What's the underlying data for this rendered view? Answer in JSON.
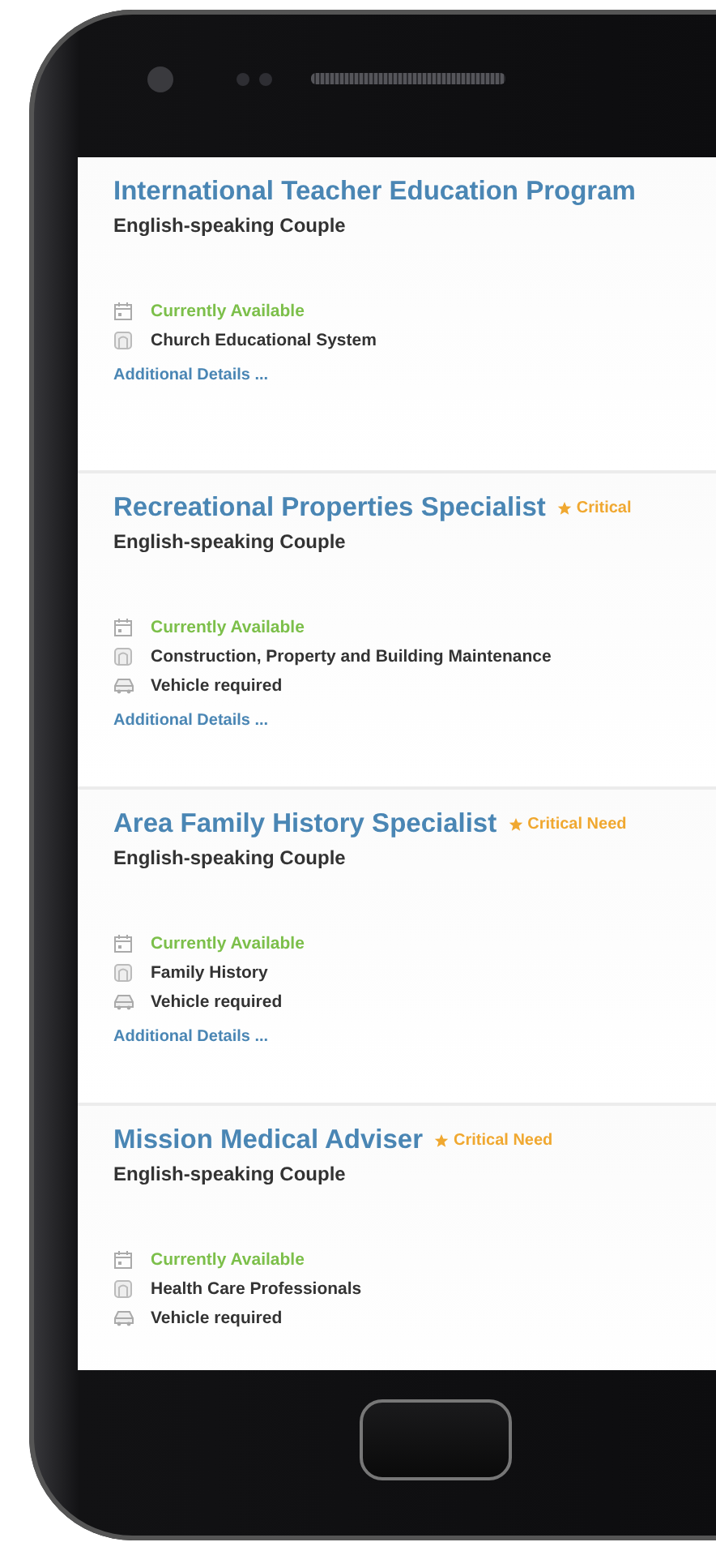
{
  "listings": [
    {
      "title": "International Teacher Education Program",
      "subtitle": "English-speaking Couple",
      "details": [
        {
          "kind": "availability",
          "text": "Currently Available"
        },
        {
          "kind": "category",
          "text": "Church Educational System"
        }
      ],
      "link": "Additional Details ..."
    },
    {
      "title": "Recreational Properties Specialist",
      "badge": "Critical",
      "subtitle": "English-speaking Couple",
      "details": [
        {
          "kind": "availability",
          "text": "Currently Available"
        },
        {
          "kind": "category",
          "text": "Construction, Property and Building Maintenance"
        },
        {
          "kind": "vehicle",
          "text": "Vehicle required"
        }
      ],
      "link": "Additional Details ..."
    },
    {
      "title": "Area Family History Specialist",
      "badge": "Critical Need",
      "subtitle": "English-speaking Couple",
      "details": [
        {
          "kind": "availability",
          "text": "Currently Available"
        },
        {
          "kind": "category",
          "text": "Family History"
        },
        {
          "kind": "vehicle",
          "text": "Vehicle required"
        }
      ],
      "link": "Additional Details ..."
    },
    {
      "title": "Mission Medical Adviser",
      "badge": "Critical Need",
      "subtitle": "English-speaking Couple",
      "details": [
        {
          "kind": "availability",
          "text": "Currently Available"
        },
        {
          "kind": "category",
          "text": "Health Care Professionals"
        },
        {
          "kind": "vehicle",
          "text": "Vehicle required"
        }
      ]
    }
  ]
}
